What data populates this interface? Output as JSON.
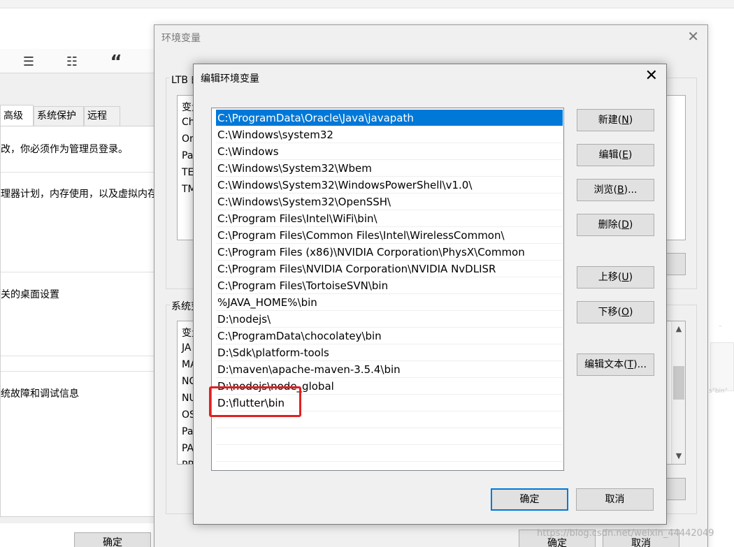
{
  "system_properties": {
    "tabs": [
      "高级",
      "系统保护",
      "远程"
    ],
    "texts": [
      "改，你必须作为管理员登录。",
      "理器计划，内存使用，以及虚拟内存",
      "关的桌面设置",
      "统故障和调试信息"
    ],
    "ok_label": "确定",
    "toolbar_icons": [
      "numbered-list-icon",
      "checklist-icon",
      "quote-icon"
    ]
  },
  "env_window": {
    "title": "环境变量",
    "user_group_label": "LTB 的用户变量(U)",
    "user_list_header": "变量",
    "user_rows": [
      "Ch",
      "On",
      "Pa",
      "TE",
      "TM"
    ],
    "system_group_label": "系统变量(S)",
    "system_list_header": "变量",
    "system_rows": [
      "JA",
      "MA",
      "NC",
      "NU",
      "OS",
      "Pa",
      "PA",
      "PR"
    ],
    "ok_label": "确定",
    "cancel_label": "取消"
  },
  "edit_dialog": {
    "title": "编辑环境变量",
    "paths": [
      "C:\\ProgramData\\Oracle\\Java\\javapath",
      "C:\\Windows\\system32",
      "C:\\Windows",
      "C:\\Windows\\System32\\Wbem",
      "C:\\Windows\\System32\\WindowsPowerShell\\v1.0\\",
      "C:\\Windows\\System32\\OpenSSH\\",
      "C:\\Program Files\\Intel\\WiFi\\bin\\",
      "C:\\Program Files\\Common Files\\Intel\\WirelessCommon\\",
      "C:\\Program Files (x86)\\NVIDIA Corporation\\PhysX\\Common",
      "C:\\Program Files\\NVIDIA Corporation\\NVIDIA NvDLISR",
      "C:\\Program Files\\TortoiseSVN\\bin",
      "%JAVA_HOME%\\bin",
      "D:\\nodejs\\",
      "C:\\ProgramData\\chocolatey\\bin",
      "D:\\Sdk\\platform-tools",
      "D:\\maven\\apache-maven-3.5.4\\bin",
      "D:\\nodejs\\node_global",
      "D:\\flutter\\bin"
    ],
    "selected_index": 0,
    "buttons": {
      "new_label": "新建(",
      "new_key": "N",
      "edit_label": "编辑(",
      "edit_key": "E",
      "browse_label": "浏览(",
      "browse_key": "B",
      "browse_suffix": ")...",
      "delete_label": "删除(",
      "delete_key": "D",
      "move_up_label": "上移(",
      "move_up_key": "U",
      "move_down_label": "下移(",
      "move_down_key": "O",
      "edit_text_label": "编辑文本(",
      "edit_text_key": "T",
      "edit_text_suffix": ")...",
      "close_paren": ")"
    },
    "ok_label": "确定",
    "cancel_label": "取消"
  },
  "watermark": "https://blog.csdn.net/weixin_44442049",
  "colors": {
    "selection": "#0078d7",
    "highlight": "#e02020"
  }
}
